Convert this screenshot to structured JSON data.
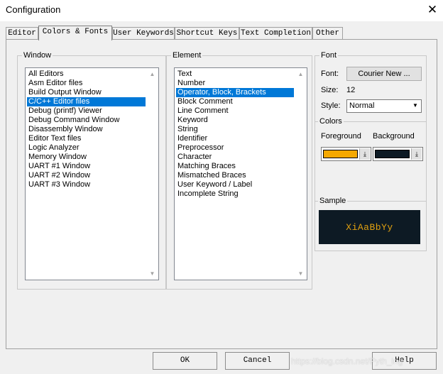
{
  "window": {
    "title": "Configuration",
    "close_glyph": "✕"
  },
  "tabs": [
    {
      "label": "Editor"
    },
    {
      "label": "Colors & Fonts",
      "active": true
    },
    {
      "label": "User Keywords"
    },
    {
      "label": "Shortcut Keys"
    },
    {
      "label": "Text Completion"
    },
    {
      "label": "Other"
    }
  ],
  "window_group": {
    "label": "Window",
    "items": [
      "All Editors",
      "Asm Editor files",
      "Build Output Window",
      "C/C++ Editor files",
      "Debug (printf) Viewer",
      "Debug Command Window",
      "Disassembly Window",
      "Editor Text files",
      "Logic Analyzer",
      "Memory Window",
      "UART #1 Window",
      "UART #2 Window",
      "UART #3 Window"
    ],
    "selected": "C/C++ Editor files"
  },
  "element_group": {
    "label": "Element",
    "items": [
      "Text",
      "Number",
      "Operator, Block, Brackets",
      "Block Comment",
      "Line Comment",
      "Keyword",
      "String",
      "Identifier",
      "Preprocessor",
      "Character",
      "Matching Braces",
      "Mismatched Braces",
      "User Keyword / Label",
      "Incomplete String"
    ],
    "selected": "Operator, Block, Brackets"
  },
  "font_group": {
    "label": "Font",
    "font_label": "Font:",
    "font_button": "Courier New ...",
    "size_label": "Size:",
    "size_value": "12",
    "style_label": "Style:",
    "style_value": "Normal"
  },
  "colors_group": {
    "label": "Colors",
    "foreground_label": "Foreground",
    "background_label": "Background",
    "foreground_color": "#f5a800",
    "background_color": "#0d1a24"
  },
  "sample_group": {
    "label": "Sample",
    "text": "XiAaBbYy",
    "text_color": "#e0a010",
    "bg_color": "#0d1a24"
  },
  "buttons": {
    "ok": "OK",
    "cancel": "Cancel",
    "help": "Help"
  },
  "watermark": "https://blog.csdn.net/Pyth_ing"
}
